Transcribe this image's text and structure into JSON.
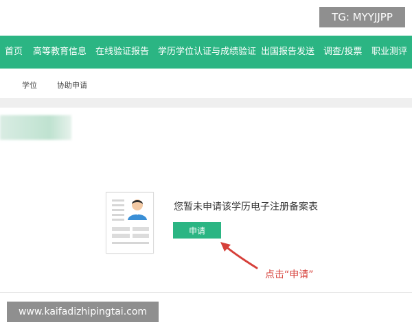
{
  "watermarks": {
    "top": "TG: MYYJJPP",
    "bottom": "www.kaifadizhipingtai.com"
  },
  "nav": {
    "items": [
      {
        "label": "首页"
      },
      {
        "label": "高等教育信息"
      },
      {
        "label": "在线验证报告"
      },
      {
        "label": "学历学位认证与成绩验证"
      },
      {
        "label": "出国报告发送"
      },
      {
        "label": "调查/投票"
      },
      {
        "label": "职业测评"
      }
    ]
  },
  "subnav": {
    "items": [
      {
        "label": "学位"
      },
      {
        "label": "协助申请"
      }
    ]
  },
  "empty_state": {
    "message": "您暂未申请该学历电子注册备案表",
    "button_label": "申请"
  },
  "annotation": {
    "text": "点击“申请”"
  },
  "colors": {
    "brand_green": "#2bb583",
    "annotation_red": "#d6403a"
  },
  "icons": {
    "document": "document-avatar-illustration",
    "arrow": "red-arrow-pointer"
  }
}
